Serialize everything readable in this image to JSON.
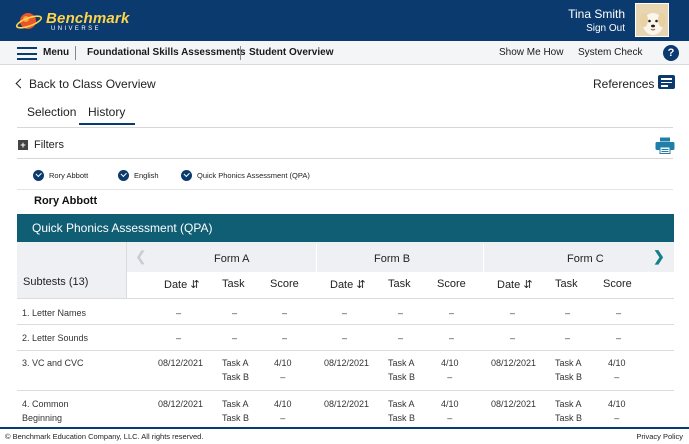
{
  "header": {
    "logo_word": "Benchmark",
    "logo_sub": "UNIVERSE",
    "user_name": "Tina Smith",
    "sign_out": "Sign Out"
  },
  "nav": {
    "menu": "Menu",
    "items": [
      "Foundational Skills Assessments",
      "Student Overview"
    ],
    "show_me_how": "Show Me How",
    "system_check": "System Check",
    "help": "?"
  },
  "page": {
    "back": "Back to Class Overview",
    "references": "References",
    "tabs": [
      "Selection",
      "History"
    ],
    "active_tab": "History",
    "filters": "Filters",
    "filter_chips": [
      "Rory Abbott",
      "English",
      "Quick Phonics Assessment (QPA)"
    ],
    "student_name": "Rory Abbott",
    "assessment_title": "Quick Phonics Assessment (QPA)"
  },
  "table": {
    "subtests_label": "Subtests (13)",
    "forms": [
      "Form A",
      "Form B",
      "Form C"
    ],
    "col_headers": {
      "date": "Date",
      "task": "Task",
      "score": "Score"
    },
    "rows": [
      {
        "label": "1. Letter Names",
        "cells": [
          [
            "–",
            "–",
            "–"
          ],
          [
            "–",
            "–",
            "–"
          ],
          [
            "–",
            "–",
            "–"
          ]
        ]
      },
      {
        "label": "2. Letter Sounds",
        "cells": [
          [
            "–",
            "–",
            "–"
          ],
          [
            "–",
            "–",
            "–"
          ],
          [
            "–",
            "–",
            "–"
          ]
        ]
      },
      {
        "label": "3. VC and CVC",
        "cells": [
          [
            "08/12/2021",
            "Task A\nTask B",
            "4/10\n–"
          ],
          [
            "08/12/2021",
            "Task A\nTask B",
            "4/10\n–"
          ],
          [
            "08/12/2021",
            "Task A\nTask B",
            "4/10\n–"
          ]
        ]
      },
      {
        "label": "4. Common\nBeginning",
        "cells": [
          [
            "08/12/2021",
            "Task A\nTask B",
            "4/10\n–"
          ],
          [
            "08/12/2021",
            "Task A\nTask B",
            "4/10\n–"
          ],
          [
            "08/12/2021",
            "Task A\nTask B",
            "4/10\n–"
          ]
        ]
      }
    ]
  },
  "footer": {
    "copyright": "© Benchmark Education Company, LLC. All rights reserved.",
    "privacy": "Privacy Policy"
  },
  "colors": {
    "header_bg": "#0b3a6e",
    "accent_teal": "#0f5e74",
    "logo_yellow": "#ffd34a"
  }
}
